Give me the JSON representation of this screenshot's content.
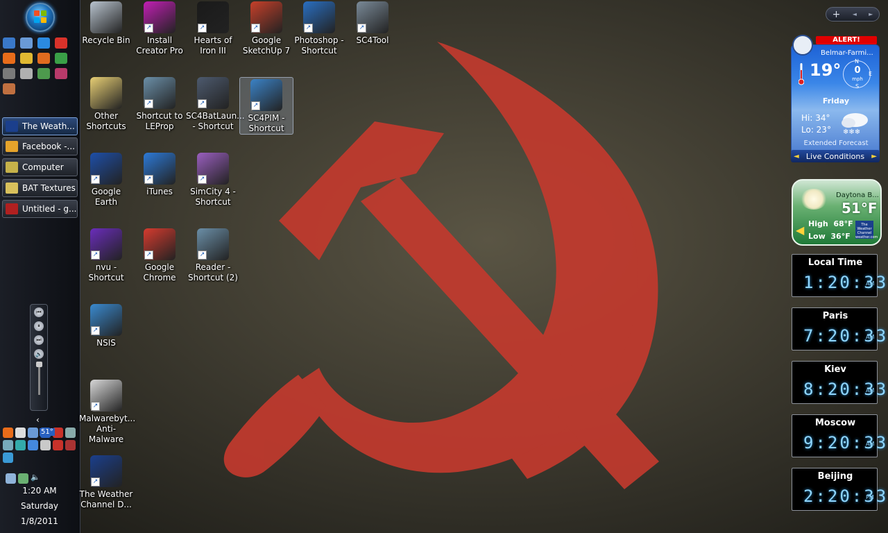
{
  "taskbar": {
    "tasks": [
      {
        "label": "The Weath...",
        "active": true,
        "color": "#1b3f8c"
      },
      {
        "label": "Facebook -...",
        "active": false,
        "color": "#e5a32b"
      },
      {
        "label": "Computer",
        "active": false,
        "color": "#c6b24a"
      },
      {
        "label": "BAT Textures",
        "active": false,
        "color": "#d8c05c"
      },
      {
        "label": "Untitled - g...",
        "active": false,
        "color": "#b02020"
      }
    ],
    "tray_temp": "51°",
    "clock": {
      "time": "1:20 AM",
      "day": "Saturday",
      "date": "1/8/2011"
    }
  },
  "desktop_icons": [
    {
      "label": "Recycle Bin",
      "color": "#b9c4cf"
    },
    {
      "label": "Install Creator Pro",
      "color": "#c21fb4"
    },
    {
      "label": "Hearts of Iron III",
      "color": "#1a1a1a"
    },
    {
      "label": "Google SketchUp 7",
      "color": "#c7402a"
    },
    {
      "label": "Photoshop - Shortcut",
      "color": "#2a6fc2"
    },
    {
      "label": "SC4Tool",
      "color": "#7a8a98"
    },
    {
      "label": "Other Shortcuts",
      "color": "#e8cf74"
    },
    {
      "label": "Shortcut to LEProp",
      "color": "#6b8fa8"
    },
    {
      "label": "SC4BatLaun... - Shortcut",
      "color": "#4d5a6e"
    },
    {
      "label": "SC4PIM - Shortcut",
      "color": "#3b82c6"
    },
    {
      "label": "Google Earth",
      "color": "#1e4fa8"
    },
    {
      "label": "iTunes",
      "color": "#2d7ad8"
    },
    {
      "label": "SimCity 4 - Shortcut",
      "color": "#9a5fbf"
    },
    {
      "label": "nvu - Shortcut",
      "color": "#6a2dbb"
    },
    {
      "label": "Google Chrome",
      "color": "#d63b2f"
    },
    {
      "label": "Reader - Shortcut (2)",
      "color": "#6b8fa8"
    },
    {
      "label": "NSIS",
      "color": "#3a8ad0"
    },
    {
      "label": "Malwarebyt... Anti-Malware",
      "color": "#d8d8d8"
    },
    {
      "label": "The Weather Channel D...",
      "color": "#1b3f8c"
    }
  ],
  "sidebar_controls": {
    "add": "+",
    "prev": "◄",
    "next": "►"
  },
  "weather1": {
    "alert": "ALERT!",
    "location": "Belmar-Farmi...",
    "temp": "19°",
    "wind_speed": "0",
    "wind_unit": "mph",
    "compass_n": "N",
    "compass_s": "S",
    "compass_e": "E",
    "day": "Friday",
    "hi": "Hi: 34°",
    "lo": "Lo: 23°",
    "extended": "Extended Forecast",
    "live": "Live Conditions"
  },
  "weather2": {
    "city": "Daytona B...",
    "temp": "51°F",
    "high_label": "High",
    "high": "68°F",
    "low_label": "Low",
    "low": "36°F",
    "logo": "The Weather Channel weather.com"
  },
  "clocks": [
    {
      "city": "Local Time",
      "time": "1:20:33",
      "ampm": "AM"
    },
    {
      "city": "Paris",
      "time": "7:20:33",
      "ampm": "AM"
    },
    {
      "city": "Kiev",
      "time": "8:20:33",
      "ampm": "AM"
    },
    {
      "city": "Moscow",
      "time": "9:20:33",
      "ampm": "AM"
    },
    {
      "city": "Beijing",
      "time": "2:20:33",
      "ampm": "PM"
    }
  ],
  "colors": {
    "hammer_sickle": "#c23a2e",
    "taskbar": "#12151b"
  }
}
